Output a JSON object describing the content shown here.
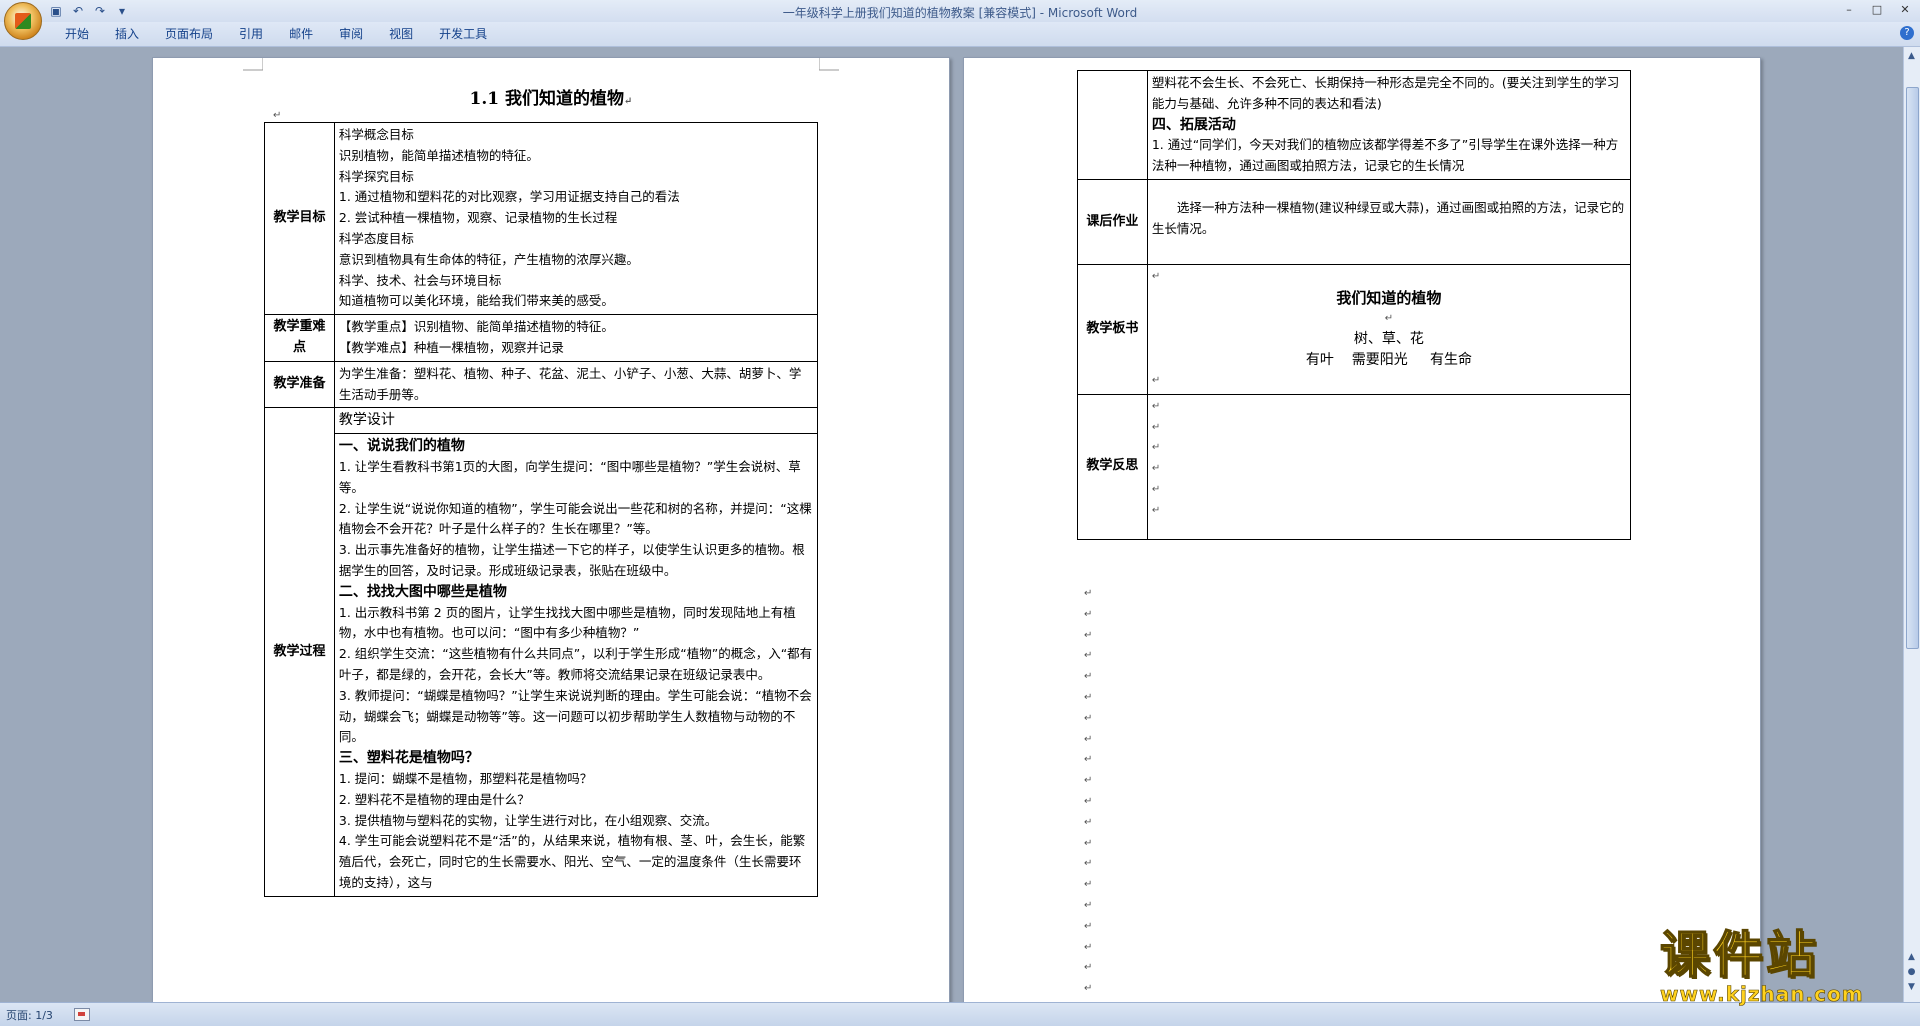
{
  "window": {
    "title": "一年级科学上册我们知道的植物教案 [兼容模式] - Microsoft Word",
    "controls": [
      "–",
      "□",
      "✕"
    ]
  },
  "quick_access": {
    "save_icon": "save-icon",
    "undo_icon": "undo-icon",
    "redo_icon": "redo-icon"
  },
  "ribbon": {
    "tabs": [
      "开始",
      "插入",
      "页面布局",
      "引用",
      "邮件",
      "审阅",
      "视图",
      "开发工具"
    ]
  },
  "status": {
    "page": "页面: 1/3"
  },
  "watermark": {
    "main": "课件站",
    "url": "www.kjzhan.com"
  },
  "page1": {
    "heading": "1.1  我们知道的植物",
    "rows": [
      {
        "label": "教学目标",
        "lines": [
          "科学概念目标",
          "识别植物，能简单描述植物的特征。",
          "科学探究目标",
          "1. 通过植物和塑料花的对比观察，学习用证据支持自己的看法",
          "2. 尝试种植一棵植物，观察、记录植物的生长过程",
          "科学态度目标",
          "意识到植物具有生命体的特征，产生植物的浓厚兴趣。",
          "科学、技术、社会与环境目标",
          "知道植物可以美化环境，能给我们带来美的感受。"
        ]
      },
      {
        "label": "教学重难点",
        "lines": [
          "【教学重点】识别植物、能简单描述植物的特征。",
          "【教学难点】种植一棵植物，观察并记录"
        ]
      },
      {
        "label": "教学准备",
        "lines": [
          "为学生准备：塑料花、植物、种子、花盆、泥土、小铲子、小葱、大蒜、胡萝卜、学生活动手册等。"
        ]
      },
      {
        "label": "教学过程",
        "design_header": "教学设计",
        "sections": [
          {
            "title": "一、说说我们的植物",
            "paras": [
              "1. 让学生看教科书第1页的大图，向学生提问：“图中哪些是植物？”学生会说树、草等。",
              "2. 让学生说“说说你知道的植物”，学生可能会说出一些花和树的名称，并提问：“这棵植物会不会开花？叶子是什么样子的？生长在哪里？”等。",
              "3. 出示事先准备好的植物，让学生描述一下它的样子，以使学生认识更多的植物。根据学生的回答，及时记录。形成班级记录表，张贴在班级中。"
            ]
          },
          {
            "title": "二、找找大图中哪些是植物",
            "paras": [
              "1. 出示教科书第 2 页的图片，让学生找找大图中哪些是植物，同时发现陆地上有植物，水中也有植物。也可以问：“图中有多少种植物？”",
              "2. 组织学生交流：“这些植物有什么共同点”，以利于学生形成“植物”的概念，入“都有叶子，都是绿的，会开花，会长大”等。教师将交流结果记录在班级记录表中。",
              "3. 教师提问：“蝴蝶是植物吗？”让学生来说说判断的理由。学生可能会说：“植物不会动，蝴蝶会飞；蝴蝶是动物等”等。这一问题可以初步帮助学生人数植物与动物的不同。"
            ]
          },
          {
            "title": "三、塑料花是植物吗？",
            "paras": [
              "1. 提问：蝴蝶不是植物，那塑料花是植物吗？",
              "2. 塑料花不是植物的理由是什么？",
              "3. 提供植物与塑料花的实物，让学生进行对比，在小组观察、交流。",
              "4. 学生可能会说塑料花不是“活”的，从结果来说，植物有根、茎、叶，会生长，能繁殖后代，会死亡，同时它的生长需要水、阳光、空气、一定的温度条件（生长需要环境的支持），这与"
            ]
          }
        ]
      }
    ]
  },
  "page2": {
    "continuation": "塑料花不会生长、不会死亡、长期保持一种形态是完全不同的。(要关注到学生的学习能力与基础、允许多种不同的表达和看法)",
    "section4_title": "四、拓展活动",
    "section4_text": "1. 通过“同学们，今天对我们的植物应该都学得差不多了”引导学生在课外选择一种方法种一种植物，通过画图或拍照方法，记录它的生长情况",
    "homework_label": "课后作业",
    "homework_text": "选择一种方法种一棵植物(建议种绿豆或大蒜)，通过画图或拍照的方法，记录它的生长情况。",
    "board_label": "教学板书",
    "board_title": "我们知道的植物",
    "board_line1": "树、草、花",
    "board_line2": "有叶    需要阳光     有生命",
    "reflection_label": "教学反思"
  }
}
